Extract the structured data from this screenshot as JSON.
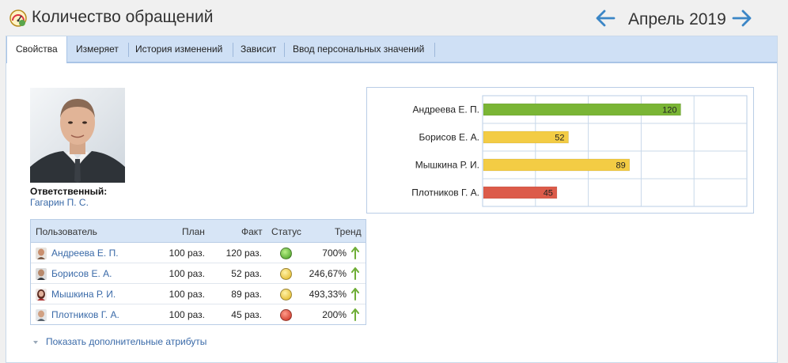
{
  "header": {
    "title": "Количество обращений",
    "period": "Апрель 2019"
  },
  "tabs": [
    {
      "label": "Свойства",
      "active": true
    },
    {
      "label": "Измеряет",
      "active": false
    },
    {
      "label": "История изменений",
      "active": false
    },
    {
      "label": "Зависит",
      "active": false
    },
    {
      "label": "Ввод персональных значений",
      "active": false
    }
  ],
  "responsible": {
    "label": "Ответственный:",
    "name": "Гагарин П. С."
  },
  "table": {
    "columns": {
      "user": "Пользователь",
      "plan": "План",
      "fact": "Факт",
      "status": "Статус",
      "trend": "Тренд"
    },
    "rows": [
      {
        "user": "Андреева Е. П.",
        "plan": "100 раз.",
        "fact": "120 раз.",
        "status": "green",
        "trend": "700%",
        "trend_dir": "up"
      },
      {
        "user": "Борисов Е. А.",
        "plan": "100 раз.",
        "fact": "52 раз.",
        "status": "yellow",
        "trend": "246,67%",
        "trend_dir": "up"
      },
      {
        "user": "Мышкина Р. И.",
        "plan": "100 раз.",
        "fact": "89 раз.",
        "status": "yellow",
        "trend": "493,33%",
        "trend_dir": "up"
      },
      {
        "user": "Плотников Г. А.",
        "plan": "100 раз.",
        "fact": "45 раз.",
        "status": "red",
        "trend": "200%",
        "trend_dir": "up"
      }
    ]
  },
  "more_attributes": "Показать дополнительные атрибуты",
  "colors": {
    "green": "#7ab535",
    "yellow": "#f3cc44",
    "red": "#dc5b4a",
    "link": "#3a6aa8",
    "trend_up": "#6fae37"
  },
  "chart_data": {
    "type": "bar",
    "orientation": "horizontal",
    "categories": [
      "Андреева Е. П.",
      "Борисов Е. А.",
      "Мышкина Р. И.",
      "Плотников Г. А."
    ],
    "values": [
      120,
      52,
      89,
      45
    ],
    "bar_colors": [
      "#7ab535",
      "#f3cc44",
      "#f3cc44",
      "#dc5b4a"
    ],
    "xlim": [
      0,
      160
    ],
    "grid": true,
    "data_labels": true
  }
}
